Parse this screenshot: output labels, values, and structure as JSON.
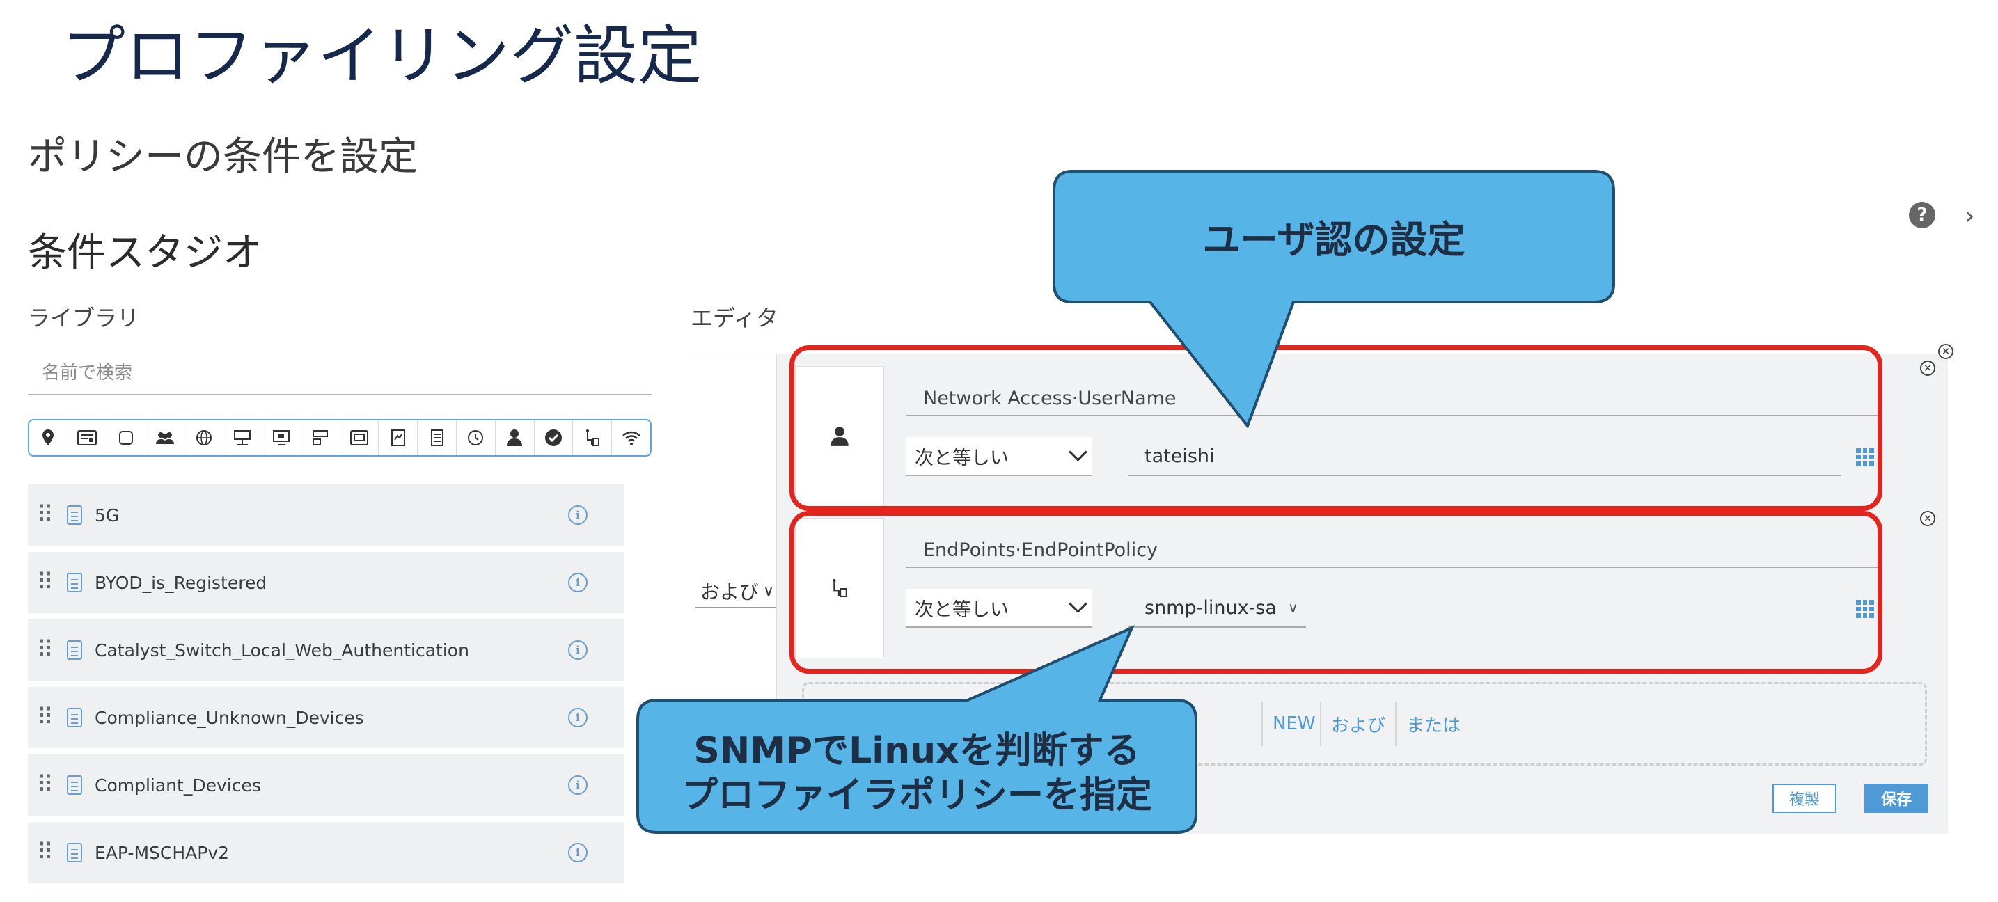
{
  "slide": {
    "title": "プロファイリング設定",
    "subtitle": "ポリシーの条件を設定"
  },
  "studio": {
    "title": "条件スタジオ",
    "library_label": "ライブラリ",
    "editor_label": "エディタ"
  },
  "search": {
    "placeholder": "名前で検索"
  },
  "filter_icons": [
    "location-icon",
    "id-card-icon",
    "square-icon",
    "group-icon",
    "globe-icon",
    "network-device-icon",
    "monitor-icon",
    "device-type-icon",
    "portal-icon",
    "certificate-icon",
    "server-icon",
    "clock-icon",
    "user-icon",
    "check-circle-icon",
    "endpoint-icon",
    "wifi-icon"
  ],
  "library_items": [
    {
      "label": "5G"
    },
    {
      "label": "BYOD_is_Registered"
    },
    {
      "label": "Catalyst_Switch_Local_Web_Authentication"
    },
    {
      "label": "Compliance_Unknown_Devices"
    },
    {
      "label": "Compliant_Devices"
    },
    {
      "label": "EAP-MSCHAPv2"
    }
  ],
  "editor": {
    "operator": "および",
    "conditions": [
      {
        "icon": "user-icon",
        "attribute": "Network Access·UserName",
        "operator": "次と等しい",
        "value": "tateishi"
      },
      {
        "icon": "endpoint-icon",
        "attribute": "EndPoints·EndPointPolicy",
        "operator": "次と等しい",
        "value": "snmp-linux-sa"
      }
    ],
    "add_buttons": {
      "new": "NEW",
      "and": "および",
      "or": "または"
    },
    "duplicate_label": "複製",
    "save_label": "保存"
  },
  "callouts": {
    "top": "ユーザ認の設定",
    "bottom_line1": "SNMPでLinuxを判断する",
    "bottom_line2": "プロファイラポリシーを指定"
  },
  "colors": {
    "title": "#16284b",
    "accent": "#4d9ad6",
    "highlight": "#e3251d",
    "callout_fill": "#56b4e6",
    "callout_border": "#1f4e6e"
  }
}
